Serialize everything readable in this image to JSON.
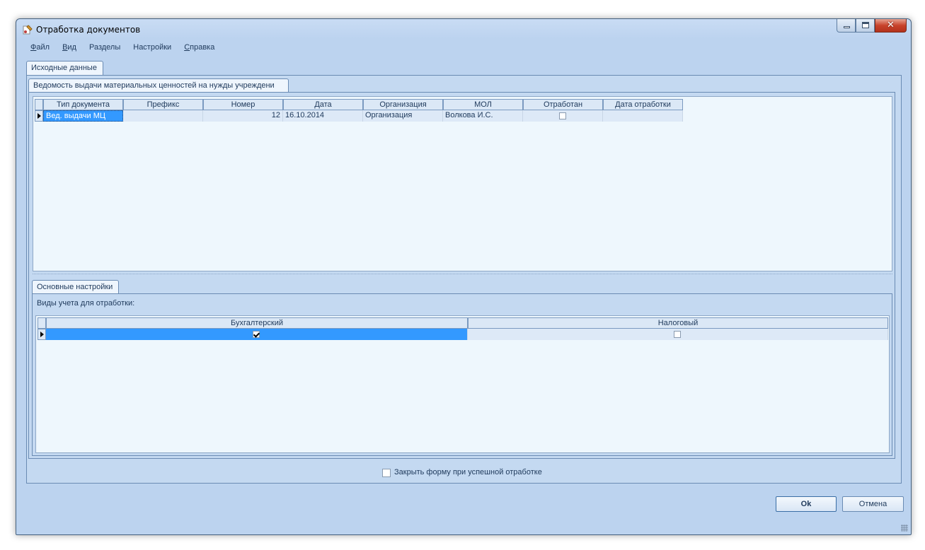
{
  "window": {
    "title": "Отработка документов"
  },
  "menu": [
    {
      "underline": "Ф",
      "rest": "айл"
    },
    {
      "underline": "В",
      "rest": "ид"
    },
    {
      "underline": "",
      "rest": "Разделы"
    },
    {
      "underline": "",
      "rest": "Настройки"
    },
    {
      "underline": "С",
      "rest": "правка"
    }
  ],
  "outer_tab": {
    "label": "Исходные данные"
  },
  "doc_tab": {
    "label": "Ведомость выдачи материальных ценностей на нужды учреждени"
  },
  "doc_grid": {
    "columns": [
      "Тип документа",
      "Префикс",
      "Номер",
      "Дата",
      "Организация",
      "МОЛ",
      "Отработан",
      "Дата отработки"
    ],
    "row": {
      "doc_type": "Вед. выдачи МЦ",
      "prefix": "",
      "number": "12",
      "date": "16.10.2014",
      "organization": "Организация",
      "mol": "Волкова И.С.",
      "processed": false,
      "processed_date": ""
    }
  },
  "settings_tab": {
    "label": "Основные настройки"
  },
  "settings": {
    "label": "Виды учета для отработки:",
    "columns": [
      "Бухгалтерский",
      "Налоговый"
    ],
    "row": {
      "accounting": true,
      "tax": false
    }
  },
  "close_on_success": {
    "label": "Закрыть форму при успешной отработке",
    "checked": false
  },
  "buttons": {
    "ok": "Ok",
    "cancel": "Отмена"
  },
  "colors": {
    "selected_cell": "#3399ff",
    "window_bg": "#bcd3ef",
    "grid_bg": "#eef7fd"
  }
}
